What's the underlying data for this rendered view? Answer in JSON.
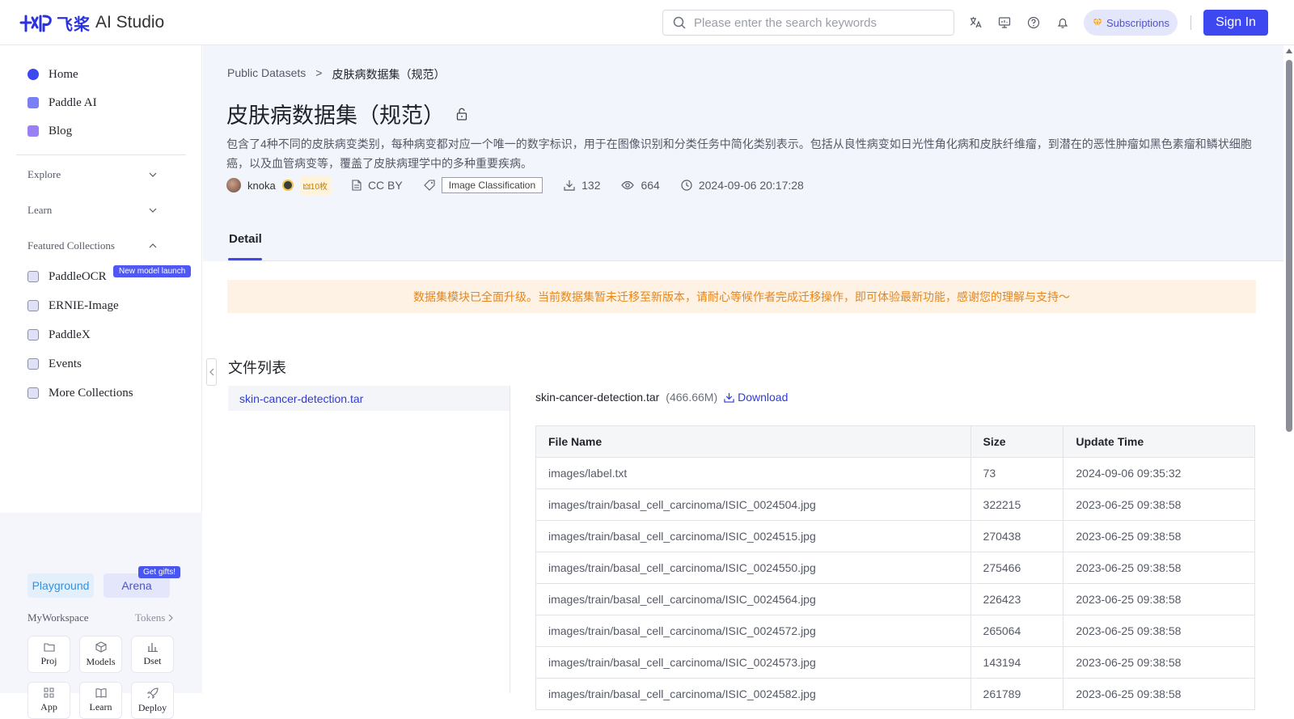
{
  "header": {
    "logo_cn": "飞桨",
    "logo_en": "AI Studio",
    "search_placeholder": "Please enter the search keywords",
    "subscriptions_label": "Subscriptions",
    "signin_label": "Sign In"
  },
  "sidebar": {
    "nav": [
      {
        "label": "Home",
        "icon": "home-icon"
      },
      {
        "label": "Paddle AI",
        "icon": "paddle-ai-icon"
      },
      {
        "label": "Blog",
        "icon": "blog-icon"
      }
    ],
    "sections": {
      "explore": "Explore",
      "learn": "Learn",
      "featured": "Featured Collections"
    },
    "collections": [
      {
        "label": "PaddleOCR",
        "icon": "paddleocr-icon"
      },
      {
        "label": "ERNIE-Image",
        "icon": "ernie-image-icon"
      },
      {
        "label": "PaddleX",
        "icon": "paddlex-icon"
      },
      {
        "label": "Events",
        "icon": "flag-icon"
      },
      {
        "label": "More Collections",
        "icon": "more-collections-icon"
      }
    ],
    "new_badge": "New model launch",
    "workspace": {
      "playground": "Playground",
      "arena": "Arena",
      "gift_badge": "Get gifts!",
      "label": "MyWorkspace",
      "tokens": "Tokens",
      "tiles": [
        {
          "label": "Proj",
          "icon": "folder-icon"
        },
        {
          "label": "Models",
          "icon": "cube-icon"
        },
        {
          "label": "Dset",
          "icon": "bar-chart-icon"
        },
        {
          "label": "App",
          "icon": "grid-icon"
        },
        {
          "label": "Learn",
          "icon": "book-icon"
        },
        {
          "label": "Deploy",
          "icon": "rocket-icon"
        }
      ]
    }
  },
  "breadcrumb": {
    "root": "Public Datasets",
    "sep": ">",
    "current": "皮肤病数据集（规范）"
  },
  "dataset": {
    "title": "皮肤病数据集（规范）",
    "description": "包含了4种不同的皮肤病变类别，每种病变都对应一个唯一的数字标识，用于在图像识别和分类任务中简化类别表示。包括从良性病变如日光性角化病和皮肤纤维瘤，到潜在的恶性肿瘤如黑色素瘤和鳞状细胞癌，以及血管病变等，覆盖了皮肤病理学中的多种重要疾病。",
    "author": "knoka",
    "coins": "🜲10枚",
    "license": "CC BY",
    "tag": "Image Classification",
    "downloads": "132",
    "views": "664",
    "updated": "2024-09-06 20:17:28"
  },
  "tabs": {
    "detail": "Detail"
  },
  "notice": "数据集模块已全面升级。当前数据集暂未迁移至新版本，请耐心等候作者完成迁移操作，即可体验最新功能，感谢您的理解与支持～",
  "files": {
    "section_title": "文件列表",
    "tree_item": "skin-cancer-detection.tar",
    "selected_name": "skin-cancer-detection.tar",
    "selected_size": "(466.66M)",
    "download_label": "Download",
    "columns": [
      "File Name",
      "Size",
      "Update Time"
    ],
    "rows": [
      [
        "images/label.txt",
        "73",
        "2024-09-06 09:35:32"
      ],
      [
        "images/train/basal_cell_carcinoma/ISIC_0024504.jpg",
        "322215",
        "2023-06-25 09:38:58"
      ],
      [
        "images/train/basal_cell_carcinoma/ISIC_0024515.jpg",
        "270438",
        "2023-06-25 09:38:58"
      ],
      [
        "images/train/basal_cell_carcinoma/ISIC_0024550.jpg",
        "275466",
        "2023-06-25 09:38:58"
      ],
      [
        "images/train/basal_cell_carcinoma/ISIC_0024564.jpg",
        "226423",
        "2023-06-25 09:38:58"
      ],
      [
        "images/train/basal_cell_carcinoma/ISIC_0024572.jpg",
        "265064",
        "2023-06-25 09:38:58"
      ],
      [
        "images/train/basal_cell_carcinoma/ISIC_0024573.jpg",
        "143194",
        "2023-06-25 09:38:58"
      ],
      [
        "images/train/basal_cell_carcinoma/ISIC_0024582.jpg",
        "261789",
        "2023-06-25 09:38:58"
      ]
    ]
  },
  "colors": {
    "accent": "#3e48f0",
    "link": "#2f3bd6",
    "notice_text": "#e8851a",
    "notice_bg": "#fdf2e3"
  }
}
